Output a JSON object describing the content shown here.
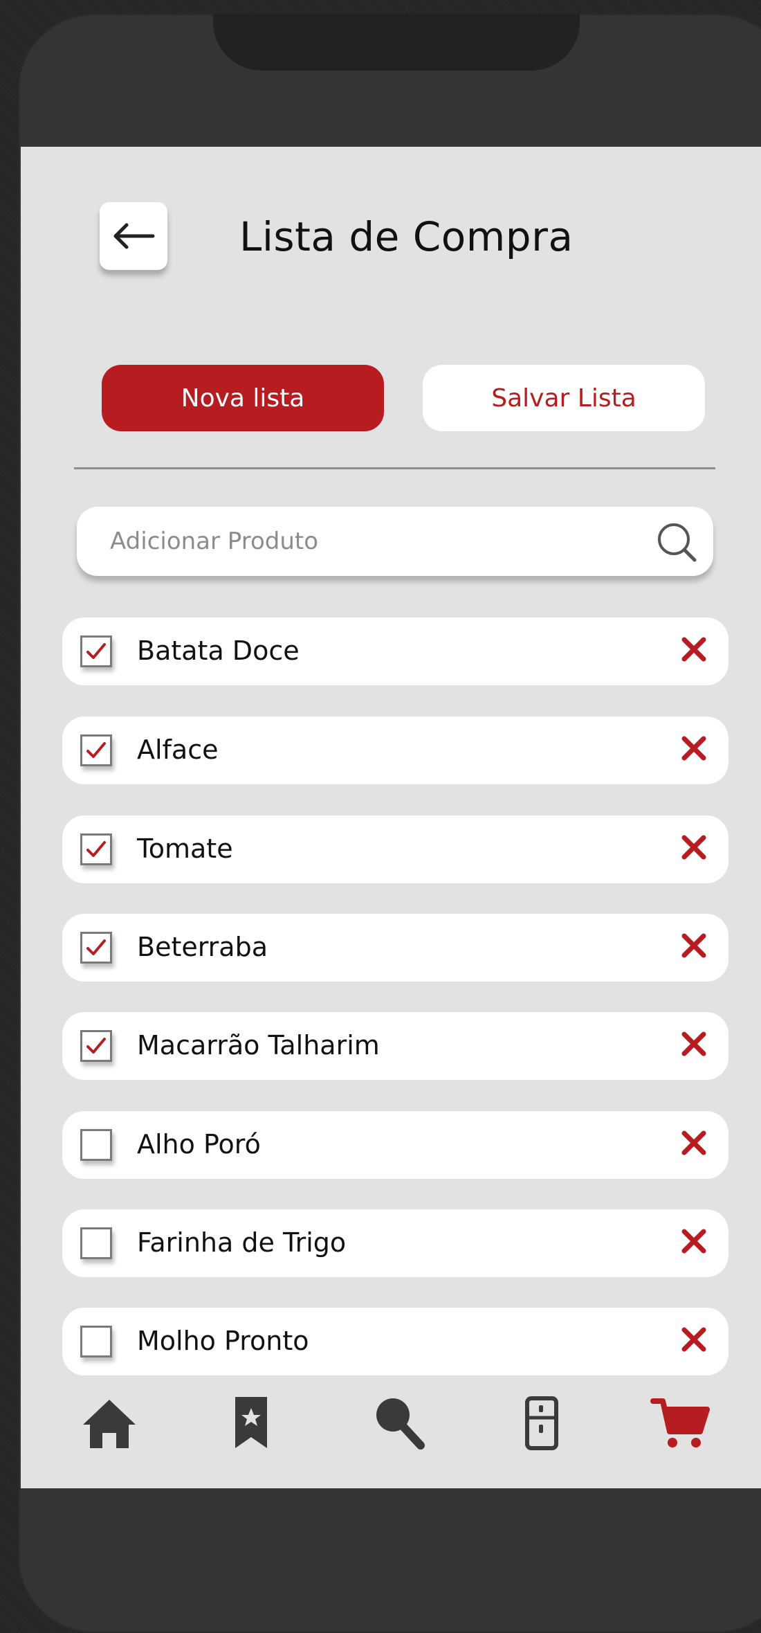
{
  "header": {
    "title": "Lista de Compra"
  },
  "actions": {
    "new_list": "Nova lista",
    "save_list": "Salvar Lista"
  },
  "search": {
    "placeholder": "Adicionar Produto"
  },
  "items": [
    {
      "label": "Batata Doce",
      "checked": true
    },
    {
      "label": "Alface",
      "checked": true
    },
    {
      "label": "Tomate",
      "checked": true
    },
    {
      "label": "Beterraba",
      "checked": true
    },
    {
      "label": "Macarrão Talharim",
      "checked": true
    },
    {
      "label": "Alho Poró",
      "checked": false
    },
    {
      "label": "Farinha de Trigo",
      "checked": false
    },
    {
      "label": "Molho Pronto",
      "checked": false
    }
  ],
  "nav": {
    "items": [
      {
        "icon": "home-icon",
        "active": false
      },
      {
        "icon": "bookmark-icon",
        "active": false
      },
      {
        "icon": "search-icon",
        "active": false
      },
      {
        "icon": "fridge-icon",
        "active": false
      },
      {
        "icon": "cart-icon",
        "active": true
      }
    ]
  },
  "colors": {
    "accent": "#b71c20",
    "screen_bg": "#e2e2e2",
    "nav_icon": "#3a3a3a"
  }
}
